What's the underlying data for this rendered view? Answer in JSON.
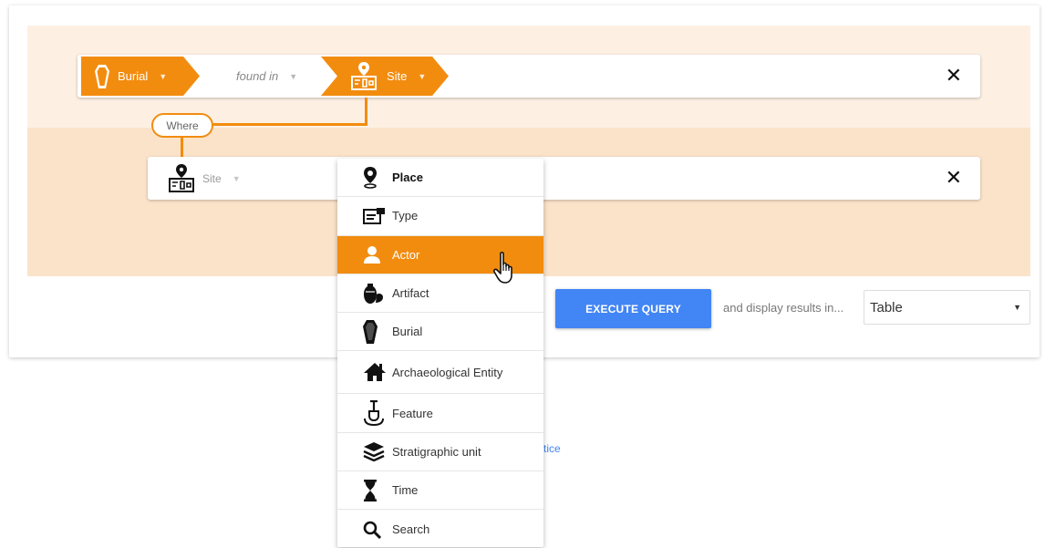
{
  "query_builder": {
    "row1": {
      "subject": {
        "label": "Burial",
        "icon": "coffin-icon"
      },
      "relation": {
        "label": "found in"
      },
      "object": {
        "label": "Site",
        "icon": "site-map-icon"
      },
      "close": "✕"
    },
    "where_label": "Where",
    "row2": {
      "subject": {
        "label": "Site",
        "icon": "site-map-icon"
      },
      "close": "✕"
    }
  },
  "dropdown": {
    "items": [
      {
        "label": "Place",
        "icon": "map-pin-icon",
        "style": "bold"
      },
      {
        "label": "Type",
        "icon": "type-tag-icon",
        "style": "normal"
      },
      {
        "label": "Actor",
        "icon": "person-icon",
        "style": "active"
      },
      {
        "label": "Artifact",
        "icon": "vase-icon",
        "style": "normal"
      },
      {
        "label": "Burial",
        "icon": "coffin-icon",
        "style": "normal"
      },
      {
        "label": "Archaeological Entity",
        "icon": "house-icon",
        "style": "normal"
      },
      {
        "label": "Feature",
        "icon": "shovel-icon",
        "style": "normal"
      },
      {
        "label": "Stratigraphic unit",
        "icon": "layers-icon",
        "style": "normal"
      },
      {
        "label": "Time",
        "icon": "hourglass-icon",
        "style": "normal"
      },
      {
        "label": "Search",
        "icon": "search-icon",
        "style": "normal"
      }
    ]
  },
  "actions": {
    "execute_label": "EXECUTE QUERY",
    "display_label": "and display results in...",
    "results_select": {
      "selected": "Table"
    }
  },
  "partial_link_text": "tice",
  "colors": {
    "accent": "#f28c0f",
    "band_light": "#fdf0e3",
    "band_dark": "#fbe3ca",
    "primary_button": "#4285f4"
  }
}
